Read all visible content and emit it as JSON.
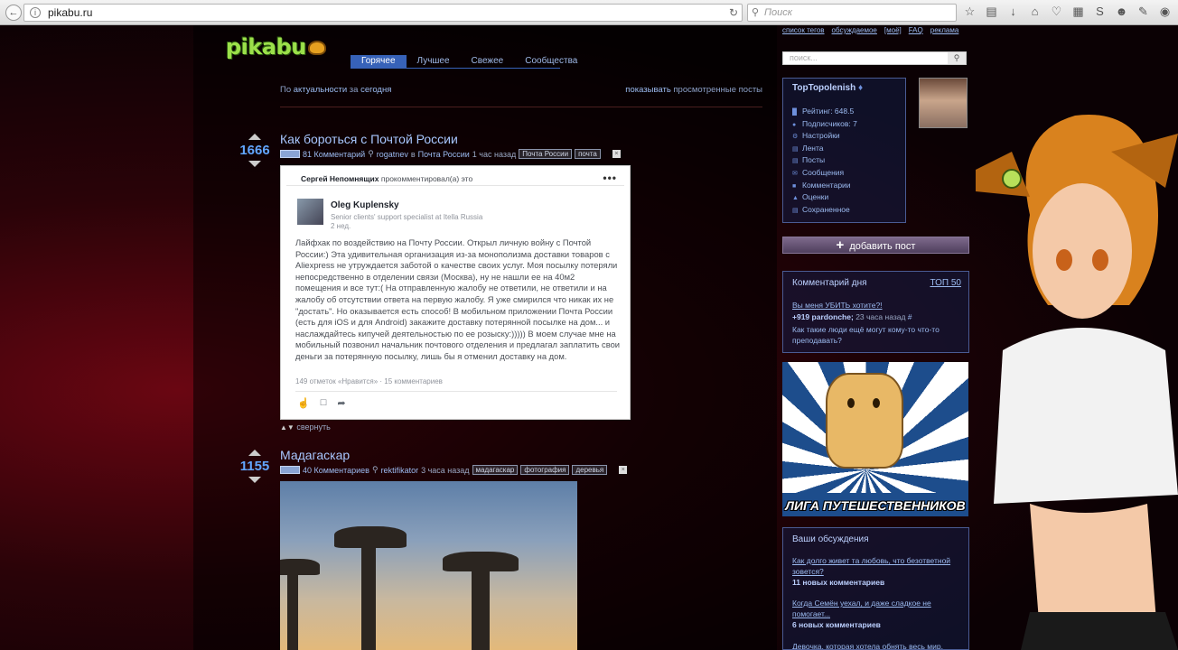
{
  "browser": {
    "url": "pikabu.ru",
    "search_placeholder": "Поиск"
  },
  "site": {
    "logo": "pikabu",
    "tabs": [
      {
        "label": "Горячее",
        "active": true
      },
      {
        "label": "Лучшее",
        "active": false
      },
      {
        "label": "Свежее",
        "active": false
      },
      {
        "label": "Сообщества",
        "active": false
      }
    ],
    "filter": {
      "prefix": "По",
      "sort": "актуальности",
      "mid": "за",
      "period": "сегодня",
      "show_link": "показывать",
      "show_rest": "просмотренные посты"
    },
    "top_links": [
      "список тегов",
      "обсуждаемое",
      "[моё]",
      "FAQ",
      "реклама"
    ],
    "search_placeholder": "поиск..."
  },
  "posts": [
    {
      "rating": "1666",
      "title": "Как бороться с Почтой России",
      "comments": "81 Комментарий",
      "author": "rogatnev",
      "in_word": "в",
      "community": "Почта России",
      "time": "1 час назад",
      "tags": [
        "Почта России",
        "почта"
      ]
    },
    {
      "rating": "1155",
      "title": "Мадагаскар",
      "comments": "40 Комментариев",
      "author": "rektifikator",
      "time": "3 часа назад",
      "tags": [
        "мадагаскар",
        "фотография",
        "деревья"
      ]
    }
  ],
  "fb": {
    "header_name": "Сергей Непомнящих",
    "header_action": "прокомментировал(а) это",
    "author_name": "Oleg Kuplensky",
    "author_role": "Senior clients' support specialist at Itella Russia",
    "author_time": "2 нед.",
    "text": "Лайфхак по воздействию на Почту России. Открыл личную войну с Почтой России:)  Эта удивительная организация из-за монополизма доставки товаров с Aliexpress не утруждается заботой о качестве своих услуг. Моя посылку потеряли непосредственно в отделении связи (Москва), ну не нашли  ее на 40м2 помещения и все тут:( На отправленную жалобу не ответили, не ответили и на жалобу об отсутствии ответа на первую жалобу. Я уже смирился что никак их не \"достать\". Но оказывается есть способ! В мобильном приложении Почта России (есть для iOS и для Android) закажите доставку потерянной посылке на дом... и наслаждайтесь кипучей деятельностью по ее розыску:))))) В моем случае мне на мобильный позвонил начальник почтового отделения и предлагал заплатить свои деньги за потерянную посылку, лишь бы я отменил доставку на дом.",
    "stats": "149 отметок «Нравится» · 15 комментариев"
  },
  "collapse_label": "свернуть",
  "sidebar": {
    "username": "TopTopolenish",
    "menu": [
      {
        "icon": "rating-icon",
        "label": "Рейтинг: 648.5"
      },
      {
        "icon": "subscribers-icon",
        "label": "Подписчиков: 7"
      },
      {
        "icon": "settings-icon",
        "label": "Настройки"
      },
      {
        "icon": "feed-icon",
        "label": "Лента"
      },
      {
        "icon": "posts-icon",
        "label": "Посты"
      },
      {
        "icon": "messages-icon",
        "label": "Сообщения"
      },
      {
        "icon": "comments-icon",
        "label": "Комментарии"
      },
      {
        "icon": "ratings-icon",
        "label": "Оценки"
      },
      {
        "icon": "saved-icon",
        "label": "Сохраненное"
      }
    ],
    "add_post": "добавить пост",
    "comment_of_day": {
      "title": "Комментарий дня",
      "top_link": "ТОП 50",
      "question": "Вы меня УБИТЬ хотите?!",
      "score": "+919",
      "author": "pardonche;",
      "time": "23 часа назад",
      "hash": "#",
      "answer": "Как такие люди ещё могут кому-то что-то преподавать?"
    },
    "league_label": "ЛИГА ПУТЕШЕСТВЕННИКОВ",
    "discussions": {
      "title": "Ваши обсуждения",
      "items": [
        {
          "question": "Как долго живет та любовь, что безответной зовется?",
          "count": "11 новых комментариев"
        },
        {
          "question": "Когда Семён уехал, и даже сладкое не помогает...",
          "count": "6 новых комментариев"
        },
        {
          "question": "Девочка, которая хотела обнять весь мир.",
          "count": ""
        }
      ]
    }
  }
}
